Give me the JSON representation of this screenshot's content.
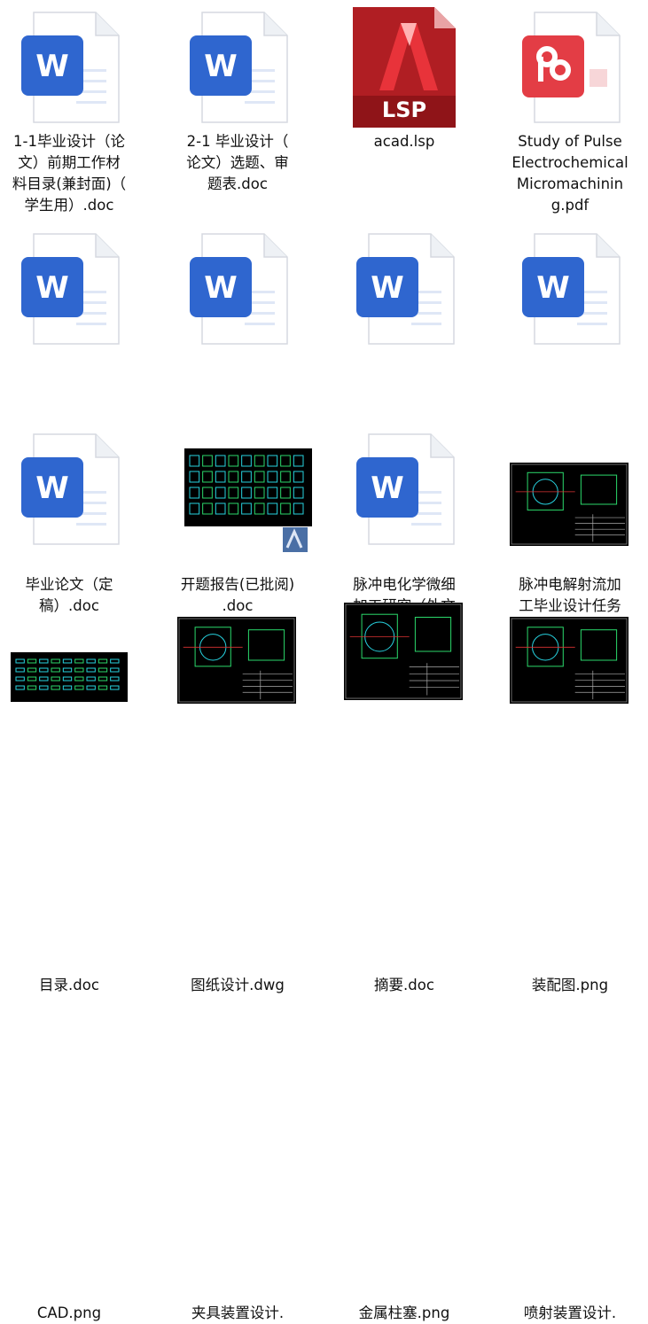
{
  "files": [
    {
      "name": "1-1毕业设计（论\n文）前期工作材\n料目录(兼封面)（\n学生用）.doc",
      "type": "word",
      "icon": "word-doc-icon"
    },
    {
      "name": "2-1 毕业设计（\n论文）选题、审\n题表.doc",
      "type": "word",
      "icon": "word-doc-icon"
    },
    {
      "name": "acad.lsp",
      "type": "lsp",
      "icon": "autocad-lsp-icon",
      "badge": "LSP"
    },
    {
      "name": "Study of Pulse\nElectrochemical\nMicromachinin\ng.pdf",
      "type": "pdf",
      "icon": "pdf-icon"
    },
    {
      "name": "毕业论文（定\n稿）.doc",
      "type": "word",
      "icon": "word-doc-icon"
    },
    {
      "name": "开题报告(已批阅)\n.doc",
      "type": "word",
      "icon": "word-doc-icon"
    },
    {
      "name": "脉冲电化学微细\n加工研究（外文\n翻译）.doc",
      "type": "word",
      "icon": "word-doc-icon"
    },
    {
      "name": "脉冲电解射流加\n工毕业设计任务\n书.doc",
      "type": "word",
      "icon": "word-doc-icon"
    },
    {
      "name": "目录.doc",
      "type": "word",
      "icon": "word-doc-icon"
    },
    {
      "name": "图纸设计.dwg",
      "type": "dwg",
      "icon": "dwg-thumbnail"
    },
    {
      "name": "摘要.doc",
      "type": "word",
      "icon": "word-doc-icon"
    },
    {
      "name": "装配图.png",
      "type": "png",
      "icon": "cad-drawing-thumbnail"
    },
    {
      "name": "CAD.png",
      "type": "png",
      "icon": "cad-drawing-thumbnail"
    },
    {
      "name": "夹具装置设计.",
      "type": "png",
      "icon": "cad-drawing-thumbnail"
    },
    {
      "name": "金属柱塞.png",
      "type": "png",
      "icon": "cad-drawing-thumbnail"
    },
    {
      "name": "喷射装置设计.",
      "type": "png",
      "icon": "cad-drawing-thumbnail"
    }
  ],
  "colors": {
    "word_blue": "#2f66cf",
    "lsp_red": "#b01e23",
    "pdf_red": "#e33d45",
    "cad_green": "#2bd96b",
    "cad_cyan": "#27d3e0"
  }
}
